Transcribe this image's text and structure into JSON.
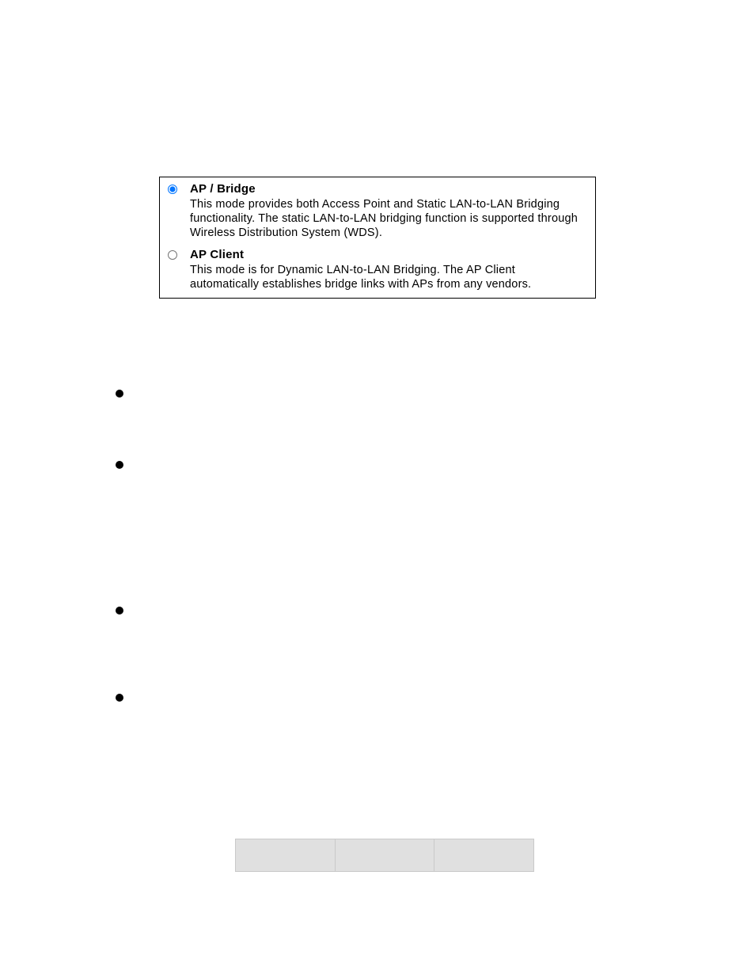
{
  "options": {
    "item1": {
      "title": "AP / Bridge",
      "desc": "This mode provides both Access Point and Static LAN-to-LAN Bridging functionality. The static LAN-to-LAN bridging function is supported through Wireless Distribution System (WDS)."
    },
    "item2": {
      "title": "AP Client",
      "desc": "This mode is for Dynamic LAN-to-LAN Bridging. The AP Client automatically establishes bridge links with APs from any vendors."
    }
  }
}
